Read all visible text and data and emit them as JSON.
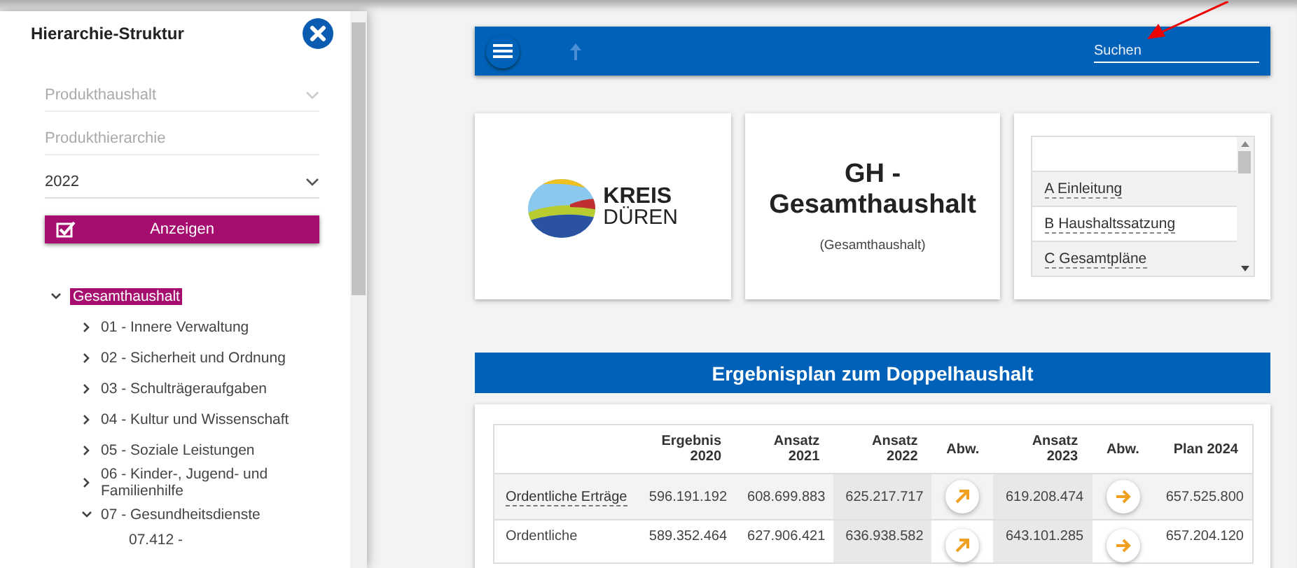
{
  "sidebar": {
    "title": "Hierarchie-Struktur",
    "fields": [
      {
        "kind": "select",
        "placeholder": "Produkthaushalt",
        "disabled": true
      },
      {
        "kind": "text",
        "placeholder": "Produkthierarchie",
        "disabled": true
      },
      {
        "kind": "select",
        "value": "2022",
        "disabled": false
      }
    ],
    "show_button": "Anzeigen",
    "tree": [
      {
        "label": "Gesamthaushalt",
        "selected": true,
        "expanded": true,
        "children": [
          {
            "label": "01 - Innere Verwaltung",
            "selected": false,
            "expanded": false
          },
          {
            "label": "02 - Sicherheit und Ordnung",
            "selected": false,
            "expanded": false
          },
          {
            "label": "03 - Schulträgeraufgaben",
            "selected": false,
            "expanded": false
          },
          {
            "label": "04 - Kultur und Wissenschaft",
            "selected": false,
            "expanded": false
          },
          {
            "label": "05 - Soziale Leistungen",
            "selected": false,
            "expanded": false
          },
          {
            "label": "06 - Kinder-, Jugend- und Familienhilfe",
            "selected": false,
            "expanded": false
          },
          {
            "label": "07 - Gesundheitsdienste",
            "selected": false,
            "expanded": true,
            "children": [
              {
                "label": "07.412 -",
                "selected": false
              }
            ]
          }
        ]
      }
    ]
  },
  "toolbar": {
    "search": {
      "placeholder": "Suchen"
    }
  },
  "cards": {
    "logo": {
      "line_1": "KREIS",
      "line_2": "DÜREN"
    },
    "title": "GH - Gesamthaushalt",
    "subtitle": "(Gesamthaushalt)",
    "chapters": [
      {
        "selected": false
      },
      {
        "label": "A Einleitung",
        "selected": false
      },
      {
        "label": "B Haushaltssatzung",
        "selected": false
      },
      {
        "label": "C Gesamtpläne",
        "selected": false
      }
    ]
  },
  "section_title": "Ergebnisplan zum Doppelhaushalt",
  "table": {
    "columns": [
      {
        "kind": "label"
      },
      {
        "label": "Ergebnis 2020",
        "kind": "number",
        "highlighted": false
      },
      {
        "label": "Ansatz 2021",
        "kind": "number",
        "highlighted": false
      },
      {
        "label": "Ansatz 2022",
        "kind": "number",
        "highlighted": true
      },
      {
        "label": "Abw.",
        "kind": "trend"
      },
      {
        "label": "Ansatz 2023",
        "kind": "number",
        "highlighted": true
      },
      {
        "label": "Abw.",
        "kind": "trend"
      },
      {
        "label": "Plan 2024",
        "kind": "number",
        "highlighted": false
      }
    ],
    "rows": [
      {
        "cells": [
          {
            "kind": "link",
            "text": "Ordentliche Erträge"
          },
          {
            "kind": "text",
            "text": "596.191.192"
          },
          {
            "kind": "text",
            "text": "608.699.883"
          },
          {
            "kind": "text",
            "text": "625.217.717"
          },
          {
            "kind": "trend_up"
          },
          {
            "kind": "text",
            "text": "619.208.474"
          },
          {
            "kind": "trend_right"
          },
          {
            "kind": "text",
            "text": "657.525.800"
          }
        ]
      },
      {
        "cells": [
          {
            "kind": "text",
            "text": "Ordentliche"
          },
          {
            "kind": "text",
            "text": "589.352.464"
          },
          {
            "kind": "text",
            "text": "627.906.421"
          },
          {
            "kind": "text",
            "text": "636.938.582"
          },
          {
            "kind": "trend_up"
          },
          {
            "kind": "text",
            "text": "643.101.285"
          },
          {
            "kind": "trend_right"
          },
          {
            "kind": "text",
            "text": "657.204.120"
          }
        ]
      }
    ]
  }
}
